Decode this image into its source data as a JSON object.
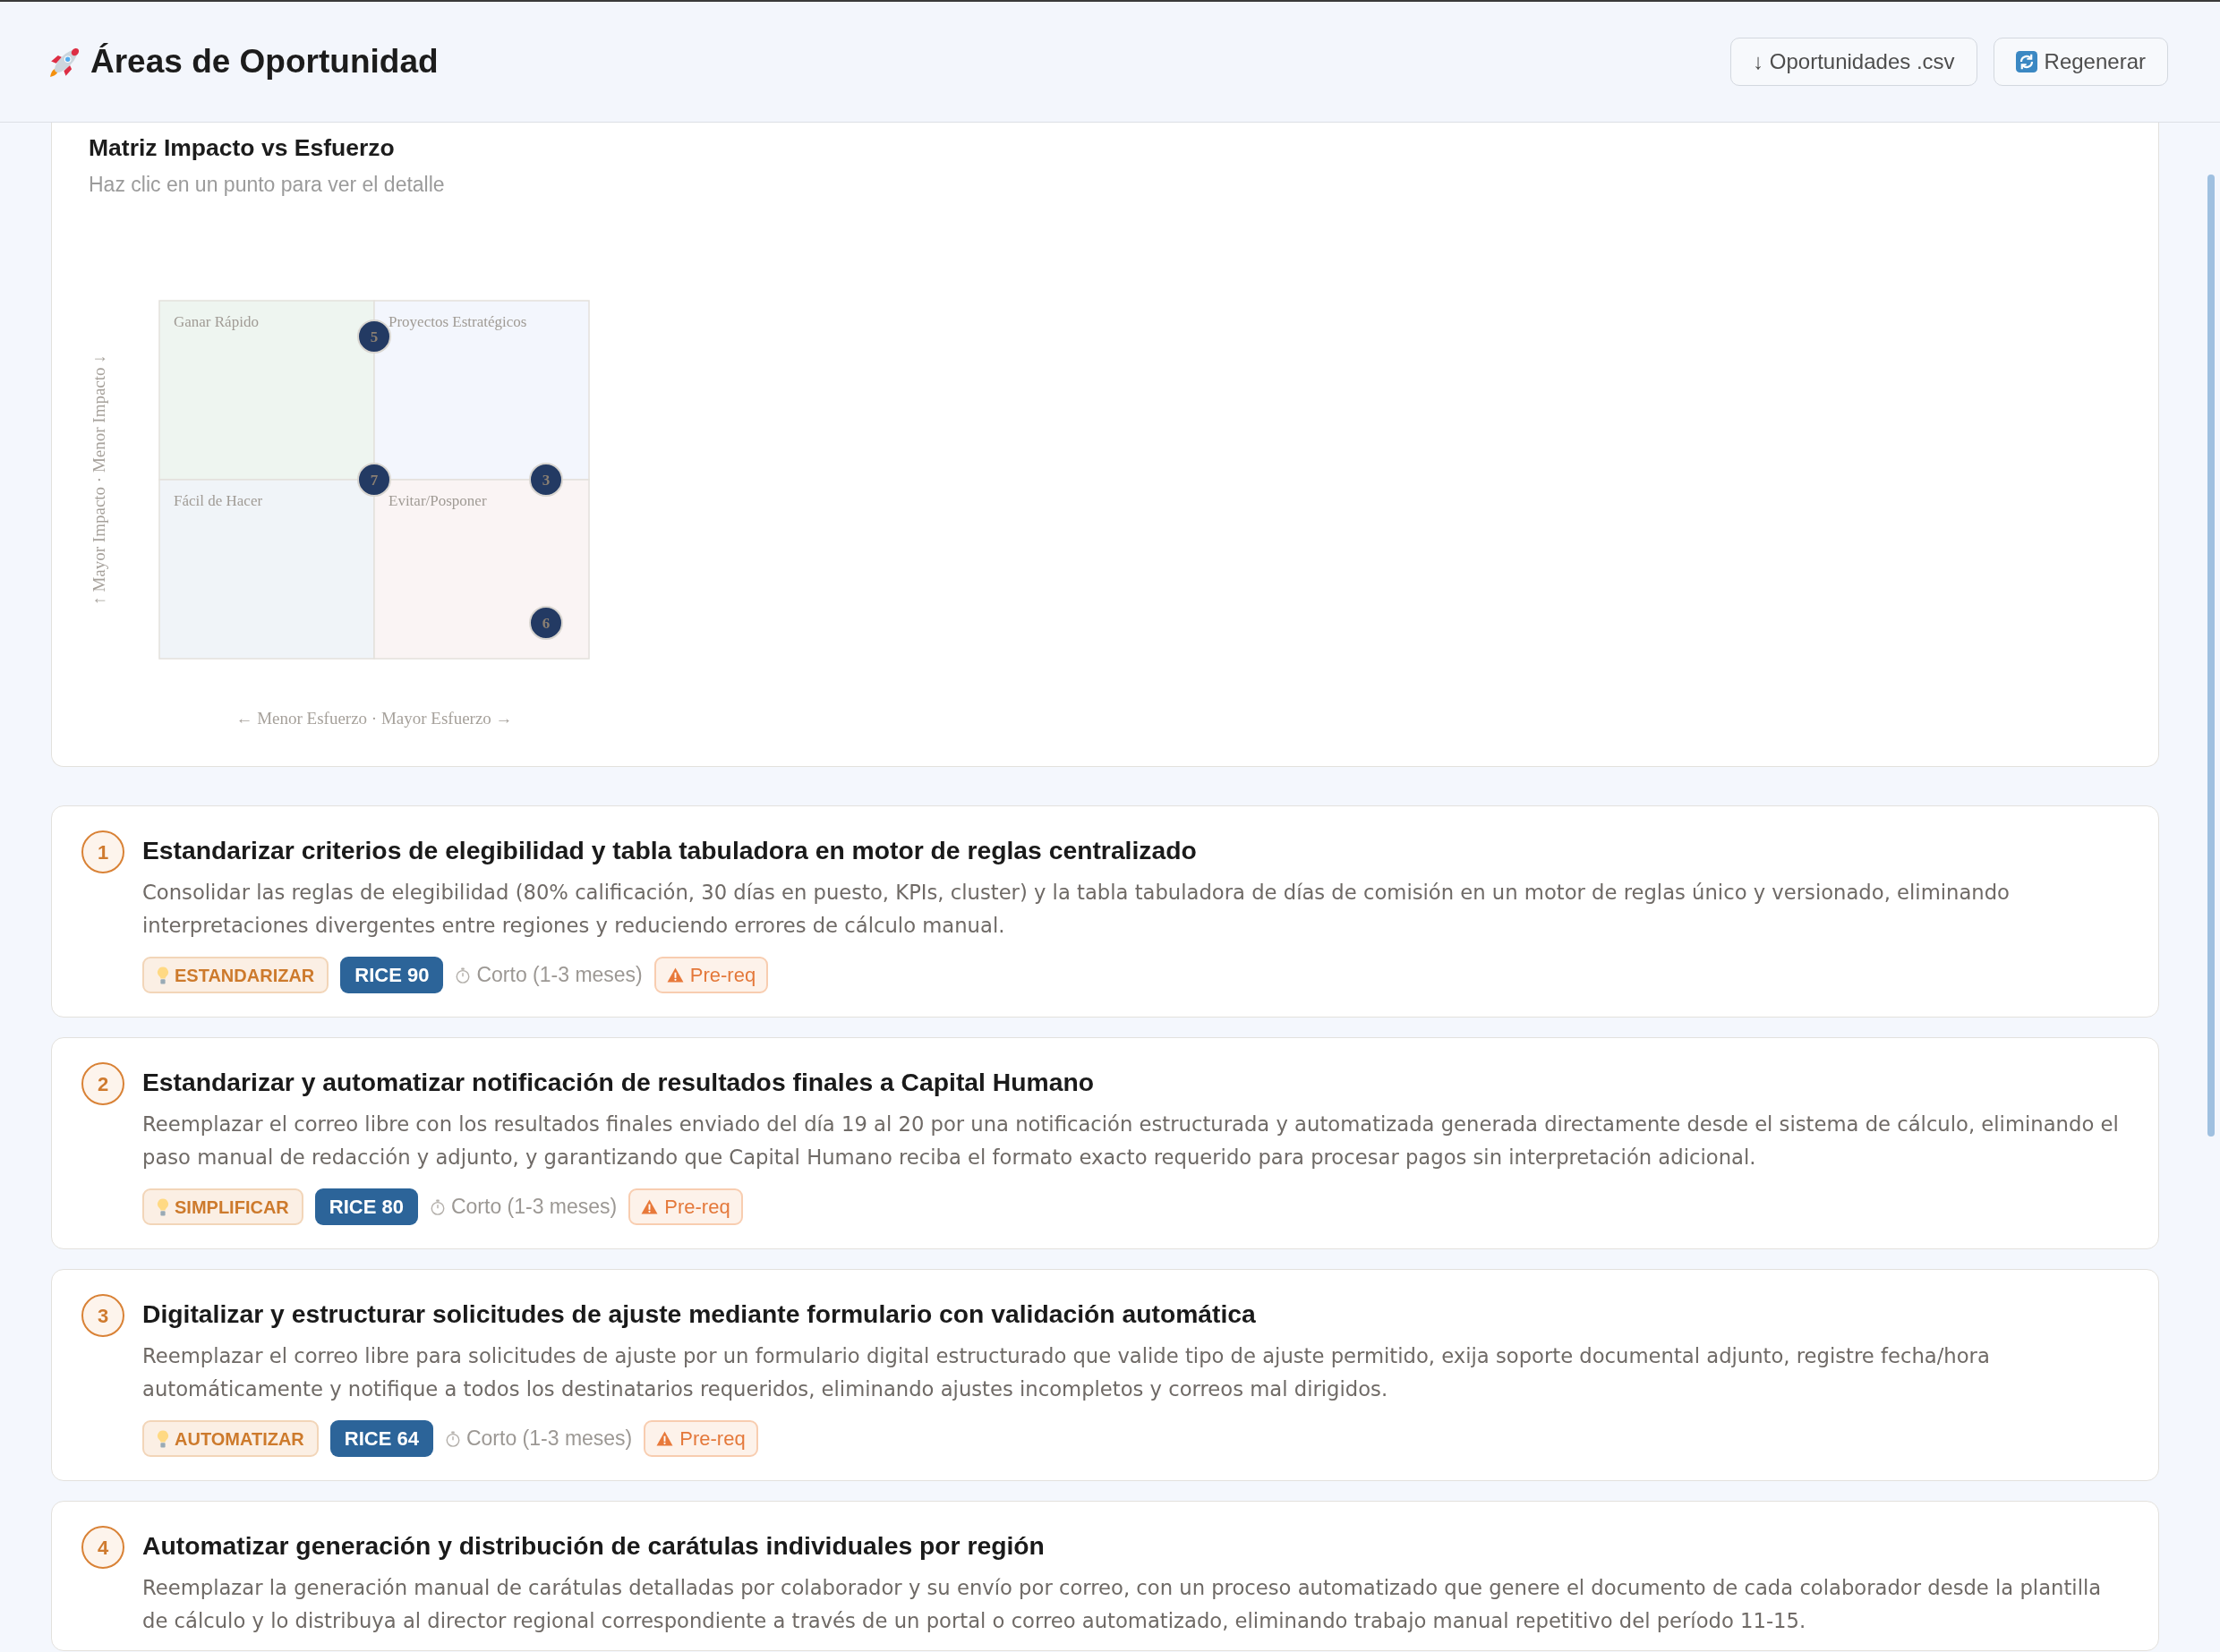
{
  "header": {
    "title": "Áreas de Oportunidad",
    "buttons": [
      {
        "kind": "download",
        "label": "↓ Oportunidades .csv"
      },
      {
        "kind": "regenerate",
        "label": "Regenerar"
      }
    ]
  },
  "matrix": {
    "title": "Matriz Impacto vs Esfuerzo",
    "subtitle": "Haz clic en un punto para ver el detalle",
    "quadrants": [
      {
        "label": "Ganar Rápido",
        "color": "#eef5f0"
      },
      {
        "label": "Proyectos Estratégicos",
        "color": "#f3f6fd"
      },
      {
        "label": "Fácil de Hacer",
        "color": "#f0f4f8"
      },
      {
        "label": "Evitar/Posponer",
        "color": "#faf4f4"
      }
    ],
    "x_axis_label": "← Menor Esfuerzo · Mayor Esfuerzo →",
    "y_axis_label": "↑ Mayor Impacto · Menor Impacto ↓",
    "points": [
      {
        "label": "5"
      },
      {
        "label": "7"
      },
      {
        "label": "3"
      },
      {
        "label": "6"
      }
    ]
  },
  "opportunities": [
    {
      "number": "1",
      "title": "Estandarizar criterios de elegibilidad y tabla tabuladora en motor de reglas centralizado",
      "description": "Consolidar las reglas de elegibilidad (80% calificación, 30 días en puesto, KPIs, cluster) y la tabla tabuladora de días de comisión en un motor de reglas único y versionado, eliminando interpretaciones divergentes entre regiones y reduciendo errores de cálculo manual.",
      "category": "ESTANDARIZAR",
      "rice": "RICE 90",
      "horizon": "Corto (1-3 meses)",
      "prerequisite": "Pre-req"
    },
    {
      "number": "2",
      "title": "Estandarizar y automatizar notificación de resultados finales a Capital Humano",
      "description": "Reemplazar el correo libre con los resultados finales enviado del día 19 al 20 por una notificación estructurada y automatizada generada directamente desde el sistema de cálculo, eliminando el paso manual de redacción y adjunto, y garantizando que Capital Humano reciba el formato exacto requerido para procesar pagos sin interpretación adicional.",
      "category": "SIMPLIFICAR",
      "rice": "RICE 80",
      "horizon": "Corto (1-3 meses)",
      "prerequisite": "Pre-req"
    },
    {
      "number": "3",
      "title": "Digitalizar y estructurar solicitudes de ajuste mediante formulario con validación automática",
      "description": "Reemplazar el correo libre para solicitudes de ajuste por un formulario digital estructurado que valide tipo de ajuste permitido, exija soporte documental adjunto, registre fecha/hora automáticamente y notifique a todos los destinatarios requeridos, eliminando ajustes incompletos y correos mal dirigidos.",
      "category": "AUTOMATIZAR",
      "rice": "RICE 64",
      "horizon": "Corto (1-3 meses)",
      "prerequisite": "Pre-req"
    },
    {
      "number": "4",
      "title": "Automatizar generación y distribución de carátulas individuales por región",
      "description": "Reemplazar la generación manual de carátulas detalladas por colaborador y su envío por correo, con un proceso automatizado que genere el documento de cada colaborador desde la plantilla de cálculo y lo distribuya al director regional correspondiente a través de un portal o correo automatizado, eliminando trabajo manual repetitivo del período 11-15."
    }
  ]
}
